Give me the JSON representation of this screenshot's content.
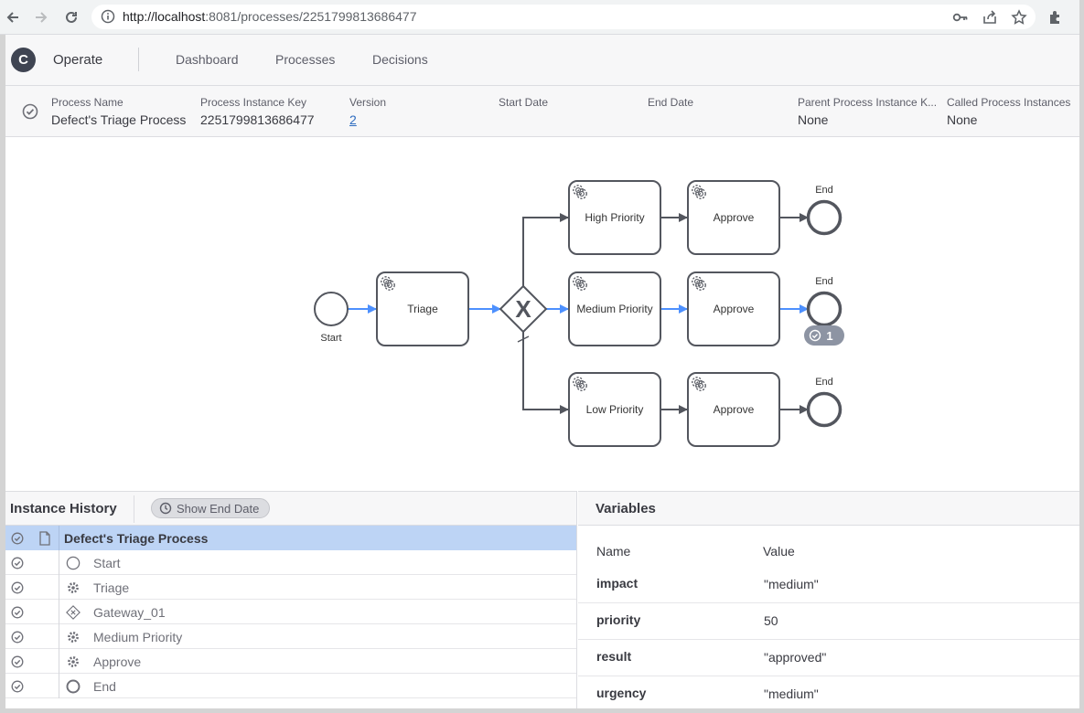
{
  "browser": {
    "url_host": "http://localhost",
    "url_path": ":8081/processes/2251799813686477"
  },
  "header": {
    "logo": "C",
    "brand": "Operate",
    "nav": [
      "Dashboard",
      "Processes",
      "Decisions"
    ]
  },
  "instance": {
    "fields": [
      {
        "label": "Process Name",
        "value": "Defect's Triage Process"
      },
      {
        "label": "Process Instance Key",
        "value": "2251799813686477"
      },
      {
        "label": "Version",
        "value": "2"
      },
      {
        "label": "Start Date",
        "value": ""
      },
      {
        "label": "End Date",
        "value": ""
      },
      {
        "label": "Parent Process Instance K...",
        "value": "None"
      },
      {
        "label": "Called Process Instances",
        "value": "None"
      }
    ]
  },
  "diagram": {
    "start_label": "Start",
    "triage": "Triage",
    "gateway_symbol": "X",
    "high": "High Priority",
    "medium": "Medium Priority",
    "low": "Low Priority",
    "approve": "Approve",
    "end_label": "End",
    "end_badge_count": "1",
    "colors": {
      "active_flow": "#4d90fe",
      "badge": "#8d94a3",
      "stroke": "#53565e"
    }
  },
  "history": {
    "title": "Instance History",
    "show_end_date": "Show End Date",
    "rows": [
      {
        "label": "Defect's Triage Process",
        "icon": "document-icon"
      },
      {
        "label": "Start",
        "icon": "start-event-icon"
      },
      {
        "label": "Triage",
        "icon": "service-task-icon"
      },
      {
        "label": "Gateway_01",
        "icon": "gateway-icon"
      },
      {
        "label": "Medium Priority",
        "icon": "service-task-icon"
      },
      {
        "label": "Approve",
        "icon": "service-task-icon"
      },
      {
        "label": "End",
        "icon": "end-event-icon"
      }
    ]
  },
  "variables": {
    "title": "Variables",
    "name_header": "Name",
    "value_header": "Value",
    "rows": [
      {
        "name": "impact",
        "value": "\"medium\""
      },
      {
        "name": "priority",
        "value": "50"
      },
      {
        "name": "result",
        "value": "\"approved\""
      },
      {
        "name": "urgency",
        "value": "\"medium\""
      }
    ]
  }
}
